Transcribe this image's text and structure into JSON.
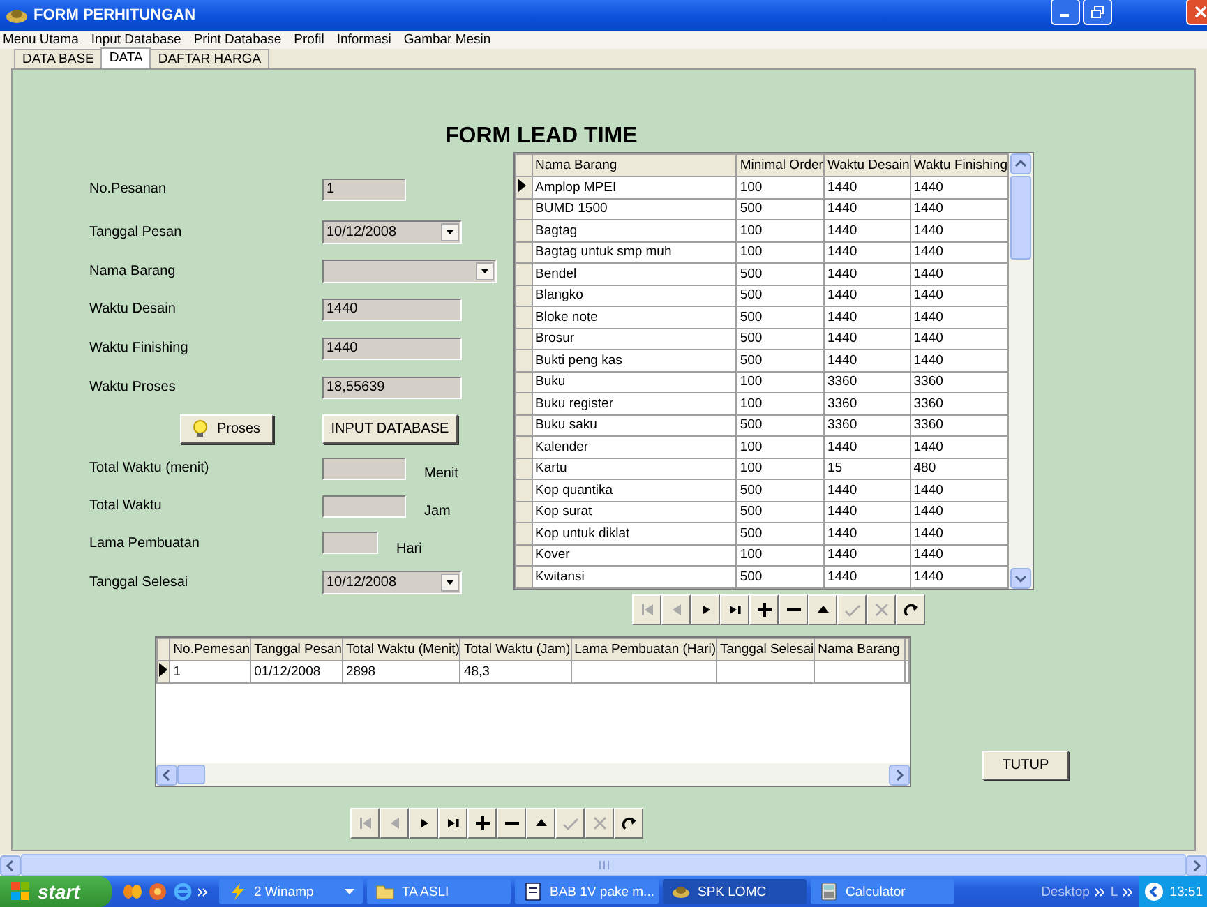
{
  "window": {
    "title": "FORM PERHITUNGAN"
  },
  "menu": [
    "Menu Utama",
    "Input Database",
    "Print Database",
    "Profil",
    "Informasi",
    "Gambar Mesin"
  ],
  "tabs": [
    {
      "label": "DATA BASE",
      "selected": false
    },
    {
      "label": "DATA",
      "selected": true
    },
    {
      "label": "DAFTAR HARGA",
      "selected": false
    }
  ],
  "form_title": "FORM LEAD TIME",
  "fields_top": [
    {
      "label": "No.Pesanan",
      "kind": "text",
      "value": "1"
    },
    {
      "label": "Tanggal Pesan",
      "kind": "dropdown",
      "value": "10/12/2008"
    },
    {
      "label": "Nama Barang",
      "kind": "dropdown"
    },
    {
      "label": "Waktu Desain",
      "kind": "text",
      "value": "1440"
    },
    {
      "label": "Waktu Finishing",
      "kind": "text",
      "value": "1440"
    },
    {
      "label": "Waktu Proses",
      "kind": "text",
      "value": "18,55639"
    }
  ],
  "actions": [
    {
      "label": "Proses",
      "kind": "bulb"
    },
    {
      "label": "INPUT DATABASE",
      "kind": "plain"
    }
  ],
  "fields_bottom": [
    {
      "label": "Total Waktu (menit)",
      "kind": "text",
      "unit": "Menit"
    },
    {
      "label": "Total Waktu",
      "kind": "text",
      "unit": "Jam"
    },
    {
      "label": "Lama Pembuatan",
      "kind": "text",
      "unit": "Hari"
    },
    {
      "label": "Tanggal Selesai",
      "kind": "dropdown",
      "value": "10/12/2008"
    }
  ],
  "items_table": {
    "columns": [
      "Nama Barang",
      "Minimal Order",
      "Waktu Desain",
      "Waktu Finishing"
    ],
    "rows": [
      {
        "cells": [
          "Amplop MPEI",
          "100",
          "1440",
          "1440"
        ],
        "selected": true
      },
      {
        "cells": [
          "BUMD 1500",
          "500",
          "1440",
          "1440"
        ],
        "selected": false
      },
      {
        "cells": [
          "Bagtag",
          "100",
          "1440",
          "1440"
        ],
        "selected": false
      },
      {
        "cells": [
          "Bagtag untuk smp muh",
          "100",
          "1440",
          "1440"
        ],
        "selected": false
      },
      {
        "cells": [
          "Bendel",
          "500",
          "1440",
          "1440"
        ],
        "selected": false
      },
      {
        "cells": [
          "Blangko",
          "500",
          "1440",
          "1440"
        ],
        "selected": false
      },
      {
        "cells": [
          "Bloke note",
          "500",
          "1440",
          "1440"
        ],
        "selected": false
      },
      {
        "cells": [
          "Brosur",
          "500",
          "1440",
          "1440"
        ],
        "selected": false
      },
      {
        "cells": [
          "Bukti peng kas",
          "500",
          "1440",
          "1440"
        ],
        "selected": false
      },
      {
        "cells": [
          "Buku",
          "100",
          "3360",
          "3360"
        ],
        "selected": false
      },
      {
        "cells": [
          "Buku register",
          "100",
          "3360",
          "3360"
        ],
        "selected": false
      },
      {
        "cells": [
          "Buku saku",
          "500",
          "3360",
          "3360"
        ],
        "selected": false
      },
      {
        "cells": [
          "Kalender",
          "100",
          "1440",
          "1440"
        ],
        "selected": false
      },
      {
        "cells": [
          "Kartu",
          "100",
          "15",
          "480"
        ],
        "selected": false
      },
      {
        "cells": [
          "Kop quantika",
          "500",
          "1440",
          "1440"
        ],
        "selected": false
      },
      {
        "cells": [
          "Kop surat",
          "500",
          "1440",
          "1440"
        ],
        "selected": false
      },
      {
        "cells": [
          "Kop untuk diklat",
          "500",
          "1440",
          "1440"
        ],
        "selected": false
      },
      {
        "cells": [
          "Kover",
          "100",
          "1440",
          "1440"
        ],
        "selected": false
      },
      {
        "cells": [
          "Kwitansi",
          "500",
          "1440",
          "1440"
        ],
        "selected": false
      }
    ]
  },
  "items_navigator": [
    {
      "kind": "first",
      "disabled": true
    },
    {
      "kind": "prior",
      "disabled": true
    },
    {
      "kind": "next",
      "disabled": false
    },
    {
      "kind": "last",
      "disabled": false
    },
    {
      "kind": "insert",
      "disabled": false
    },
    {
      "kind": "delete",
      "disabled": false
    },
    {
      "kind": "edit",
      "disabled": false
    },
    {
      "kind": "post",
      "disabled": true
    },
    {
      "kind": "cancel",
      "disabled": true
    },
    {
      "kind": "refresh",
      "disabled": false
    }
  ],
  "orders_table": {
    "columns": [
      "No.Pemesan",
      "Tanggal Pesan",
      "Total Waktu (Menit)",
      "Total Waktu (Jam)",
      "Lama Pembuatan (Hari)",
      "Tanggal Selesai",
      "Nama Barang"
    ],
    "rows": [
      {
        "cells": [
          "1",
          "01/12/2008",
          "2898",
          "48,3"
        ],
        "selected": true
      }
    ]
  },
  "close_button": "TUTUP",
  "orders_navigator": [
    {
      "kind": "first",
      "disabled": true
    },
    {
      "kind": "prior",
      "disabled": true
    },
    {
      "kind": "next",
      "disabled": false
    },
    {
      "kind": "last",
      "disabled": false
    },
    {
      "kind": "insert",
      "disabled": false
    },
    {
      "kind": "delete",
      "disabled": false
    },
    {
      "kind": "edit",
      "disabled": false
    },
    {
      "kind": "post",
      "disabled": true
    },
    {
      "kind": "cancel",
      "disabled": true
    },
    {
      "kind": "refresh",
      "disabled": false
    }
  ],
  "taskbar": {
    "start": "start",
    "tasks": [
      {
        "label": "2 Winamp",
        "kind": "group",
        "active": false
      },
      {
        "label": "TA ASLI",
        "kind": "folder",
        "active": false
      },
      {
        "label": "BAB 1V pake m...",
        "kind": "document",
        "active": false
      },
      {
        "label": "SPK LOMC",
        "kind": "app",
        "active": true
      },
      {
        "label": "Calculator",
        "kind": "calculator",
        "active": false
      }
    ],
    "toolbars": [
      "Desktop",
      "L"
    ],
    "clock": "13:51"
  }
}
